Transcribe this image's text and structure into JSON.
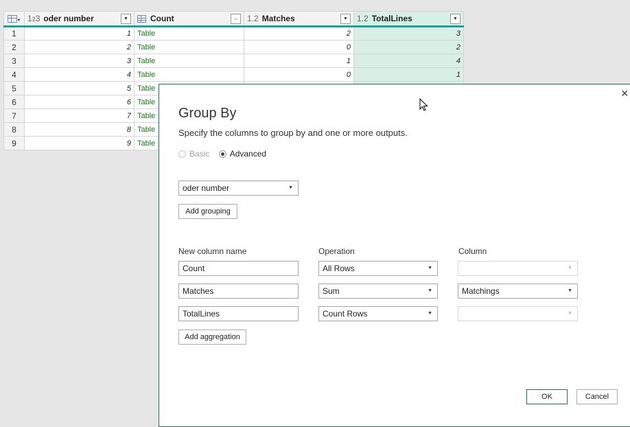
{
  "grid": {
    "headers": {
      "order": {
        "type_icon": "1²₃",
        "label": "oder number"
      },
      "count": {
        "label": "Count"
      },
      "matches": {
        "type_icon": "1.2",
        "label": "Matches"
      },
      "total": {
        "type_icon": "1.2",
        "label": "TotalLines"
      }
    },
    "rows": [
      {
        "n": "1",
        "order": "1",
        "count": "Table",
        "matches": "2",
        "total": "3"
      },
      {
        "n": "2",
        "order": "2",
        "count": "Table",
        "matches": "0",
        "total": "2"
      },
      {
        "n": "3",
        "order": "3",
        "count": "Table",
        "matches": "1",
        "total": "4"
      },
      {
        "n": "4",
        "order": "4",
        "count": "Table",
        "matches": "0",
        "total": "1"
      },
      {
        "n": "5",
        "order": "5",
        "count": "Table",
        "matches": "",
        "total": ""
      },
      {
        "n": "6",
        "order": "6",
        "count": "Table",
        "matches": "",
        "total": ""
      },
      {
        "n": "7",
        "order": "7",
        "count": "Table",
        "matches": "",
        "total": ""
      },
      {
        "n": "8",
        "order": "8",
        "count": "Table",
        "matches": "",
        "total": ""
      },
      {
        "n": "9",
        "order": "9",
        "count": "Table",
        "matches": "",
        "total": ""
      }
    ]
  },
  "dialog": {
    "close": "×",
    "title": "Group By",
    "description": "Specify the columns to group by and one or more outputs.",
    "radio_basic": "Basic",
    "radio_advanced": "Advanced",
    "grouping_select": "oder number",
    "add_grouping": "Add grouping",
    "labels": {
      "new_column": "New column name",
      "operation": "Operation",
      "column": "Column"
    },
    "aggregations": [
      {
        "name": "Count",
        "operation": "All Rows",
        "column": ""
      },
      {
        "name": "Matches",
        "operation": "Sum",
        "column": "Matchings"
      },
      {
        "name": "TotalLines",
        "operation": "Count Rows",
        "column": ""
      }
    ],
    "add_aggregation": "Add aggregation",
    "ok": "OK",
    "cancel": "Cancel"
  },
  "colors": {
    "accent": "#1aa39a",
    "highlight": "#d7efe5",
    "table_link": "#1a7a1a",
    "dialog_border": "#2e6b50"
  },
  "icons": {
    "close": "close-icon",
    "caret": "chevron-down-icon",
    "cursor": "mouse-pointer-icon"
  }
}
